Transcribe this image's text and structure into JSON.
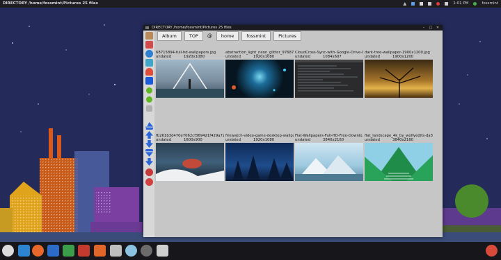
{
  "topbar": {
    "title": "DIRECTORY  /home/fossmint/Pictures 25 files",
    "time": "1:01 PM",
    "user": "fossmint"
  },
  "window": {
    "title": "DIRECTORY  /home/fossmint/Pictures 25 files"
  },
  "toolbar": {
    "album": "Album",
    "top": "TOP",
    "at": "@",
    "home": "home",
    "user": "fossmint",
    "pictures": "Pictures"
  },
  "files": [
    {
      "name": "68715894-full-hd-wallpapers.jpg",
      "date": "undated",
      "size": "1920x1080"
    },
    {
      "name": "abstraction_light_neon_glitter_97687_...",
      "date": "undated",
      "size": "1920x1080"
    },
    {
      "name": "CloudCross-Sync-with-Google-Drive-D...",
      "date": "undated",
      "size": "1084x607"
    },
    {
      "name": "dark-tree-wallpaper-1900x1200.jpg",
      "date": "undated",
      "size": "1900x1200"
    },
    {
      "name": "fb261b3d470e7062cf369421f429a72a...",
      "date": "undated",
      "size": "1600x900"
    },
    {
      "name": "firewatch-video-game-desktop-wallpa...",
      "date": "undated",
      "size": "1920x1080"
    },
    {
      "name": "Flat-Wallpapers-Full-HD-Free-Downlo...",
      "date": "undated",
      "size": "3840x2160"
    },
    {
      "name": "flat_landscape_4k_by_wolfyedits-da3...",
      "date": "undated",
      "size": "3840x2160"
    }
  ]
}
